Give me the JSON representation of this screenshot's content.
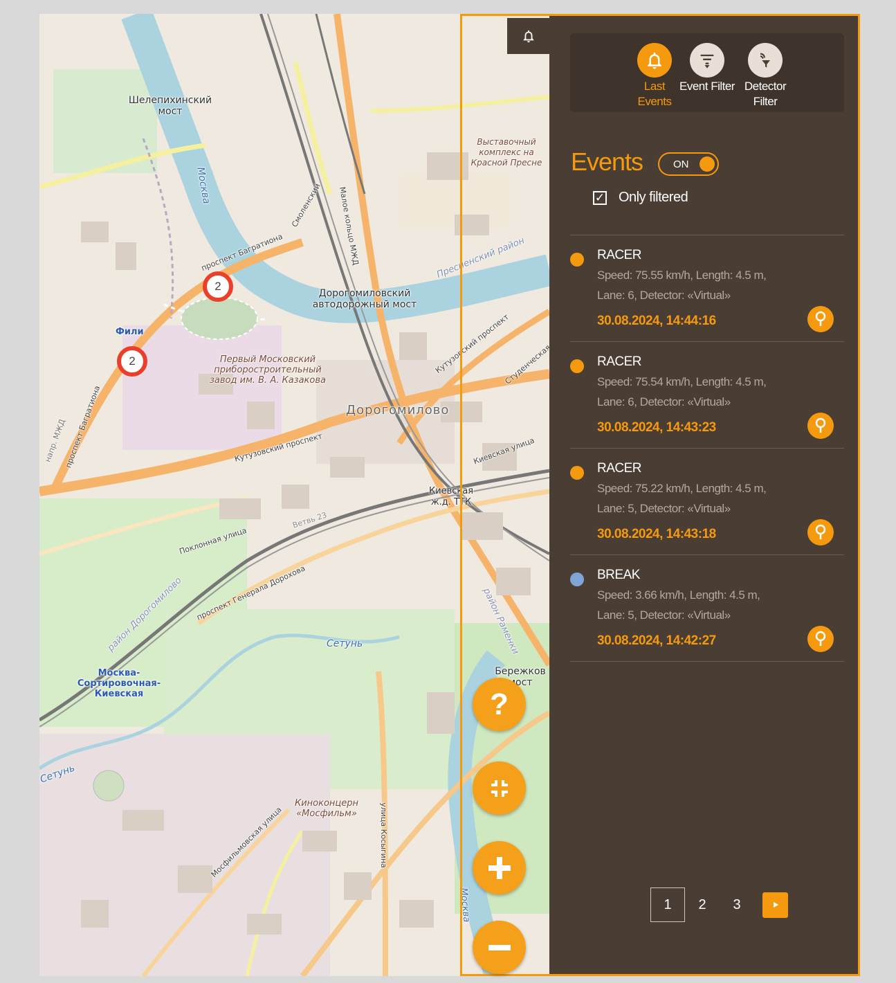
{
  "map": {
    "labels": {
      "shelepikha_bridge": "Шелепихинский мост",
      "moskva_river_1": "Москва",
      "moskva_river_2": "Москва",
      "exhibition": "Выставочный комплекс на Красной Пресне",
      "bagrationa": "проспект Багратиона",
      "smolensky": "Смоленский",
      "mkzhd": "Малое кольцо МЖД",
      "presnensky": "Пресненский район",
      "dorogomilovsky_bridge": "Дорогомиловский автодорожный мост",
      "fili": "Фили",
      "kutuzovsky": "Кутузовский проспект",
      "kutuzovsky_2": "Кутузовский проспект",
      "factory": "Первый Московский приборостроительный завод им. В. А. Казакова",
      "dorogomilovo": "Дорогомилово",
      "kievskaya": "Киевская ж.д. ТТК",
      "kievskaya_street": "Киевская улица",
      "poklonnaya": "Поклонная улица",
      "vetvi": "Ветвь 23",
      "dorokhova": "проспект Генерала Дорохова",
      "district_dorogomilovo": "район Дорогомилово",
      "setun": "Сетунь",
      "setun_2": "Сетунь",
      "moskva_sort": "Москва-Сортировочная-Киевская",
      "ramenki": "район Раменки",
      "berezhkov": "Бережков мост",
      "mosfilm": "Киноконцерн «Мосфильм»",
      "mosfilmovskaya": "Мосфильмовская улица",
      "kosygina": "улица Косыгина",
      "studencheskaya": "Студенческая",
      "bagrationa_2": "проспект Багратиона",
      "mkzhd_2": "напр. МЖД",
      "moskva_3": "Москва"
    },
    "clusters": [
      {
        "count": "2"
      },
      {
        "count": "2"
      }
    ]
  },
  "controls": {
    "help": "?",
    "fit_icon": "fullscreen-exit-icon",
    "zoom_in": "+",
    "zoom_out": "−"
  },
  "panel": {
    "bell_icon": "bell-icon",
    "tabs": [
      {
        "label": "Last Events",
        "icon": "bell-icon",
        "active": true
      },
      {
        "label": "Event Filter",
        "icon": "filter-list-icon",
        "active": false
      },
      {
        "label": "Detector Filter",
        "icon": "detector-filter-icon",
        "active": false
      }
    ],
    "title": "Events",
    "toggle": "ON",
    "only_filtered": "Only filtered",
    "only_filtered_checked": true,
    "events": [
      {
        "type": "RACER",
        "color": "#f59a0e",
        "line1": "Speed: 75.55 km/h, Length: 4.5 m,",
        "line2": "Lane: 6, Detector: «Virtual»",
        "time": "30.08.2024, 14:44:16"
      },
      {
        "type": "RACER",
        "color": "#f59a0e",
        "line1": "Speed: 75.54 km/h, Length: 4.5 m,",
        "line2": "Lane: 6, Detector: «Virtual»",
        "time": "30.08.2024, 14:43:23"
      },
      {
        "type": "RACER",
        "color": "#f59a0e",
        "line1": "Speed: 75.22 km/h, Length: 4.5 m,",
        "line2": "Lane: 5, Detector: «Virtual»",
        "time": "30.08.2024, 14:43:18"
      },
      {
        "type": "BREAK",
        "color": "#7fa4d6",
        "line1": "Speed: 3.66 km/h, Length: 4.5 m,",
        "line2": "Lane: 5, Detector: «Virtual»",
        "time": "30.08.2024, 14:42:27"
      }
    ],
    "pagination": {
      "pages": [
        "1",
        "2",
        "3"
      ],
      "current": "1",
      "next_icon": "play-arrow-icon"
    },
    "accent": "#f59a0e",
    "background": "#4a3d33"
  }
}
